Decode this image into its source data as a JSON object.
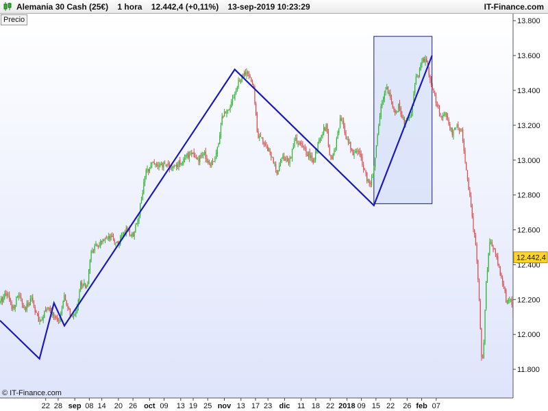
{
  "header": {
    "instrument": "Alemania 30 Cash (25€)",
    "timeframe": "1 hora",
    "last_price": "12.442,4",
    "change": "(+0,11%)",
    "datetime": "13-sep-2019 10:23:29",
    "brand": "IT-Finance.com",
    "icon": "candlestick-icon"
  },
  "panel_label": "Precio",
  "copyright": "© IT-Finance.com",
  "colors": {
    "up": "#2bb32b",
    "down": "#d94a4a",
    "trendline": "#1a1ab8",
    "zone_fill": "#d4def8",
    "zone_stroke": "#1a1a80",
    "price_tag": "#ffd52a"
  },
  "chart_data": {
    "type": "candlestick",
    "ylim": [
      11600,
      13840
    ],
    "y_ticks": [
      {
        "value": 13800,
        "label": "13.800"
      },
      {
        "value": 13600,
        "label": "13.600"
      },
      {
        "value": 13400,
        "label": "13.400"
      },
      {
        "value": 13200,
        "label": "13.200"
      },
      {
        "value": 13000,
        "label": "13.000"
      },
      {
        "value": 12800,
        "label": "12.800"
      },
      {
        "value": 12600,
        "label": "12.600"
      },
      {
        "value": 12400,
        "label": "12.400"
      },
      {
        "value": 12200,
        "label": "12.200"
      },
      {
        "value": 12000,
        "label": "12.000"
      },
      {
        "value": 11800,
        "label": "11.800"
      }
    ],
    "x_ticks": [
      {
        "t": 22,
        "label": "22",
        "bold": false
      },
      {
        "t": 28,
        "label": "28",
        "bold": false
      },
      {
        "t": 36,
        "label": "sep",
        "bold": true
      },
      {
        "t": 43,
        "label": "08",
        "bold": false
      },
      {
        "t": 49,
        "label": "14",
        "bold": false
      },
      {
        "t": 57,
        "label": "20",
        "bold": false
      },
      {
        "t": 64,
        "label": "26",
        "bold": false
      },
      {
        "t": 72,
        "label": "oct",
        "bold": true
      },
      {
        "t": 79,
        "label": "09",
        "bold": false
      },
      {
        "t": 87,
        "label": "13",
        "bold": false
      },
      {
        "t": 93,
        "label": "19",
        "bold": false
      },
      {
        "t": 100,
        "label": "25",
        "bold": false
      },
      {
        "t": 108,
        "label": "nov",
        "bold": true
      },
      {
        "t": 116,
        "label": "13",
        "bold": false
      },
      {
        "t": 123,
        "label": "17",
        "bold": false
      },
      {
        "t": 129,
        "label": "23",
        "bold": false
      },
      {
        "t": 137,
        "label": "dic",
        "bold": true
      },
      {
        "t": 145,
        "label": "11",
        "bold": false
      },
      {
        "t": 152,
        "label": "18",
        "bold": false
      },
      {
        "t": 159,
        "label": "22",
        "bold": false
      },
      {
        "t": 167,
        "label": "2018",
        "bold": true
      },
      {
        "t": 174,
        "label": "09",
        "bold": false
      },
      {
        "t": 181,
        "label": "15",
        "bold": false
      },
      {
        "t": 188,
        "label": "22",
        "bold": false
      },
      {
        "t": 196,
        "label": "26",
        "bold": false
      },
      {
        "t": 203,
        "label": "feb",
        "bold": true
      },
      {
        "t": 210,
        "label": "07",
        "bold": false
      }
    ],
    "price_path": [
      [
        0,
        12180
      ],
      [
        3,
        12250
      ],
      [
        6,
        12150
      ],
      [
        9,
        12230
      ],
      [
        12,
        12130
      ],
      [
        15,
        12220
      ],
      [
        19,
        12060
      ],
      [
        22,
        12150
      ],
      [
        26,
        12110
      ],
      [
        28,
        12060
      ],
      [
        31,
        12210
      ],
      [
        33,
        12140
      ],
      [
        35,
        12080
      ],
      [
        37,
        12160
      ],
      [
        39,
        12300
      ],
      [
        42,
        12280
      ],
      [
        44,
        12480
      ],
      [
        48,
        12520
      ],
      [
        51,
        12540
      ],
      [
        54,
        12550
      ],
      [
        57,
        12520
      ],
      [
        60,
        12600
      ],
      [
        64,
        12570
      ],
      [
        67,
        12700
      ],
      [
        70,
        12920
      ],
      [
        73,
        12990
      ],
      [
        77,
        12960
      ],
      [
        80,
        12980
      ],
      [
        83,
        12950
      ],
      [
        86,
        12980
      ],
      [
        89,
        13010
      ],
      [
        92,
        13050
      ],
      [
        95,
        12990
      ],
      [
        98,
        13040
      ],
      [
        101,
        12980
      ],
      [
        104,
        13020
      ],
      [
        107,
        13250
      ],
      [
        110,
        13300
      ],
      [
        113,
        13380
      ],
      [
        115,
        13450
      ],
      [
        117,
        13480
      ],
      [
        118,
        13500
      ],
      [
        120,
        13480
      ],
      [
        122,
        13420
      ],
      [
        124,
        13150
      ],
      [
        127,
        13100
      ],
      [
        130,
        13050
      ],
      [
        133,
        12930
      ],
      [
        136,
        13020
      ],
      [
        139,
        12980
      ],
      [
        142,
        13120
      ],
      [
        145,
        13080
      ],
      [
        148,
        13040
      ],
      [
        151,
        12990
      ],
      [
        154,
        13140
      ],
      [
        157,
        13200
      ],
      [
        159,
        13000
      ],
      [
        161,
        13050
      ],
      [
        164,
        13240
      ],
      [
        167,
        13120
      ],
      [
        170,
        13040
      ],
      [
        173,
        13050
      ],
      [
        176,
        12920
      ],
      [
        178,
        12840
      ],
      [
        180,
        12950
      ],
      [
        182,
        13180
      ],
      [
        184,
        13350
      ],
      [
        186,
        13420
      ],
      [
        188,
        13370
      ],
      [
        190,
        13250
      ],
      [
        192,
        13320
      ],
      [
        194,
        13230
      ],
      [
        196,
        13210
      ],
      [
        198,
        13270
      ],
      [
        200,
        13450
      ],
      [
        202,
        13520
      ],
      [
        204,
        13580
      ],
      [
        206,
        13540
      ],
      [
        208,
        13400
      ],
      [
        210,
        13340
      ],
      [
        212,
        13250
      ],
      [
        214,
        13270
      ],
      [
        216,
        13200
      ],
      [
        218,
        13150
      ],
      [
        220,
        13200
      ],
      [
        222,
        13180
      ],
      [
        224,
        12980
      ],
      [
        226,
        12800
      ],
      [
        228,
        12600
      ],
      [
        229,
        12500
      ],
      [
        230,
        12350
      ],
      [
        231,
        12100
      ],
      [
        232,
        11800
      ],
      [
        233,
        11980
      ],
      [
        234,
        12300
      ],
      [
        236,
        12550
      ],
      [
        238,
        12470
      ],
      [
        240,
        12400
      ],
      [
        242,
        12300
      ],
      [
        244,
        12180
      ],
      [
        246,
        12200
      ],
      [
        247,
        12110
      ]
    ],
    "trendline": [
      [
        0,
        12080
      ],
      [
        19,
        11860
      ],
      [
        26,
        12180
      ],
      [
        31,
        12050
      ],
      [
        113,
        13520
      ],
      [
        180,
        12740
      ],
      [
        208,
        13600
      ]
    ],
    "zone": {
      "t_start": 180,
      "t_end": 208,
      "y_low": 12750,
      "y_high": 13710
    },
    "last_price": {
      "value": 12442.4,
      "label": "12.442,4"
    }
  }
}
